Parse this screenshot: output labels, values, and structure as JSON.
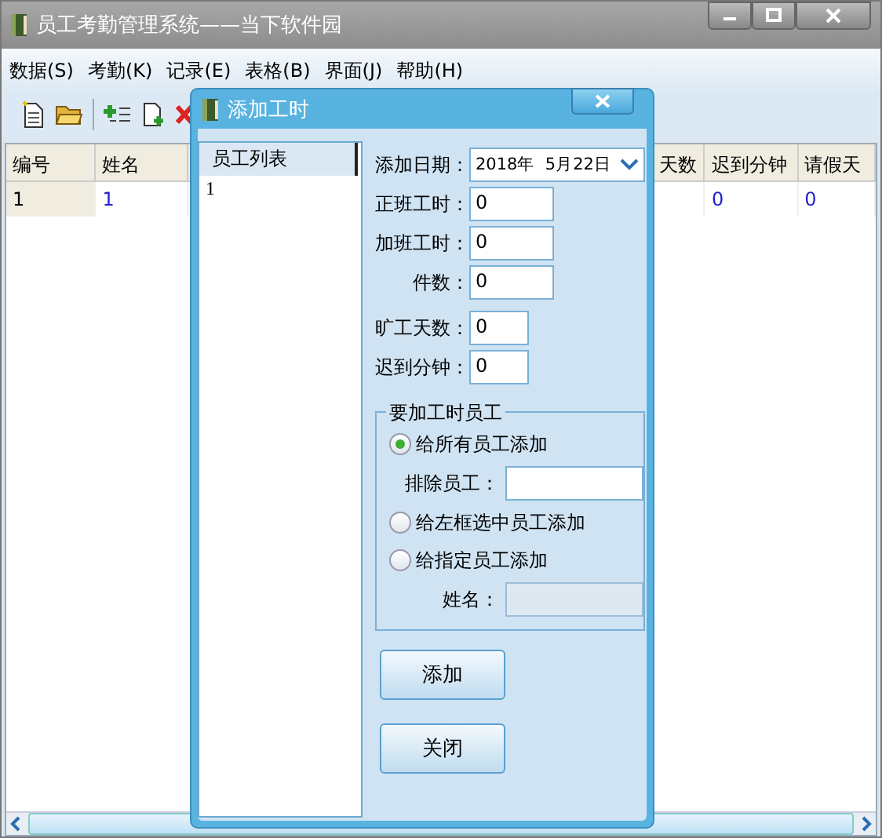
{
  "window": {
    "title": "员工考勤管理系统——当下软件园"
  },
  "menu": [
    {
      "label": "数据(S)"
    },
    {
      "label": "考勤(K)"
    },
    {
      "label": "记录(E)"
    },
    {
      "label": "表格(B)"
    },
    {
      "label": "界面(J)"
    },
    {
      "label": "帮助(H)"
    }
  ],
  "table": {
    "columns": [
      "编号",
      "姓名",
      "天数",
      "迟到分钟",
      "请假天"
    ],
    "rows": [
      {
        "cells": [
          "1",
          "1",
          null,
          "0",
          "0"
        ]
      }
    ]
  },
  "dialog": {
    "title": "添加工时",
    "list": {
      "header": "员工列表",
      "items": [
        "1"
      ]
    },
    "fields": [
      {
        "label": "添加日期：",
        "kind": "date",
        "value": "2018年  5月22日"
      },
      {
        "label": "正班工时：",
        "kind": "text",
        "value": "0"
      },
      {
        "label": "加班工时：",
        "kind": "text",
        "value": "0"
      },
      {
        "label": "件数：",
        "kind": "text",
        "value": "0"
      },
      {
        "label": "旷工天数：",
        "kind": "short",
        "value": "0"
      },
      {
        "label": "迟到分钟：",
        "kind": "short",
        "value": "0"
      }
    ],
    "group": {
      "title": "要加工时员工",
      "options": [
        {
          "label": "给所有员工添加",
          "selected": true,
          "sub": {
            "label": "排除员工：",
            "disabled": false
          }
        },
        {
          "label": "给左框选中员工添加",
          "selected": false
        },
        {
          "label": "给指定员工添加",
          "selected": false,
          "sub": {
            "label": "姓名：",
            "disabled": true
          }
        }
      ]
    },
    "buttons": [
      "添加",
      "关闭"
    ]
  }
}
